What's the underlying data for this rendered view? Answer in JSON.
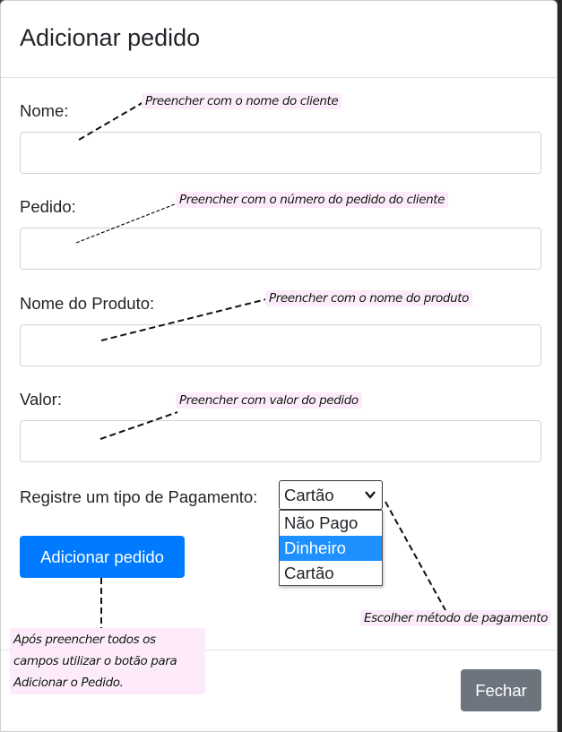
{
  "modal": {
    "title": "Adicionar pedido",
    "fields": [
      {
        "label": "Nome:",
        "value": "",
        "annotation": "Preencher com o nome do cliente"
      },
      {
        "label": "Pedido:",
        "value": "",
        "annotation": "Preencher com o número do pedido do cliente"
      },
      {
        "label": "Nome do Produto:",
        "value": "",
        "annotation": "Preencher com o nome do produto"
      },
      {
        "label": "Valor:",
        "value": "",
        "annotation": "Preencher com valor do pedido"
      }
    ],
    "payment": {
      "label": "Registre um tipo de Pagamento:",
      "selected": "Cartão",
      "options": [
        "Não Pago",
        "Dinheiro",
        "Cartão"
      ],
      "highlighted": "Dinheiro",
      "annotation": "Escolher método de pagamento"
    },
    "add_button": {
      "label": "Adicionar pedido",
      "annotation": "Após preencher todos os campos utilizar o botão para Adicionar o Pedido."
    },
    "close_button": {
      "label": "Fechar"
    }
  },
  "colors": {
    "primary": "#007bff",
    "secondary": "#6c757d",
    "highlight": "#1e90ff",
    "annotation_bg": "#fdeafa"
  }
}
